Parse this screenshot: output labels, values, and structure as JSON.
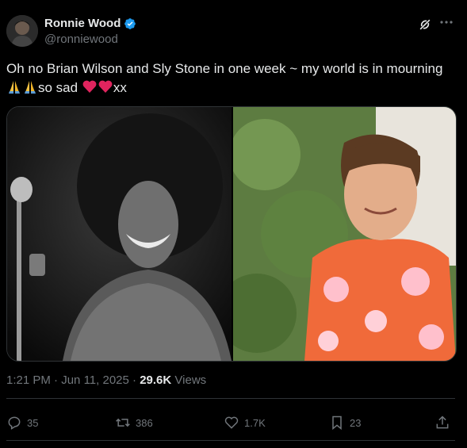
{
  "author": {
    "name": "Ronnie Wood",
    "handle": "@ronniewood",
    "verified": true
  },
  "tweet": {
    "text": "Oh no Brian Wilson and Sly Stone in one week ~ my world is in mourning",
    "text_line2": "so sad",
    "text_end": "xx",
    "emojis": [
      "folded-hands",
      "folded-hands",
      "red-heart",
      "red-heart"
    ]
  },
  "meta": {
    "time": "1:21 PM",
    "sep1": "·",
    "date": "Jun 11, 2025",
    "sep2": "·",
    "views_count": "29.6K",
    "views_label": "Views"
  },
  "actions": {
    "replies": "35",
    "reposts": "386",
    "likes": "1.7K",
    "bookmarks": "23"
  },
  "colors": {
    "background": "#000000",
    "text": "#e7e9ea",
    "muted": "#71767b",
    "verified": "#1d9bf0",
    "border": "#2f3336",
    "heart": "#e0245e"
  }
}
